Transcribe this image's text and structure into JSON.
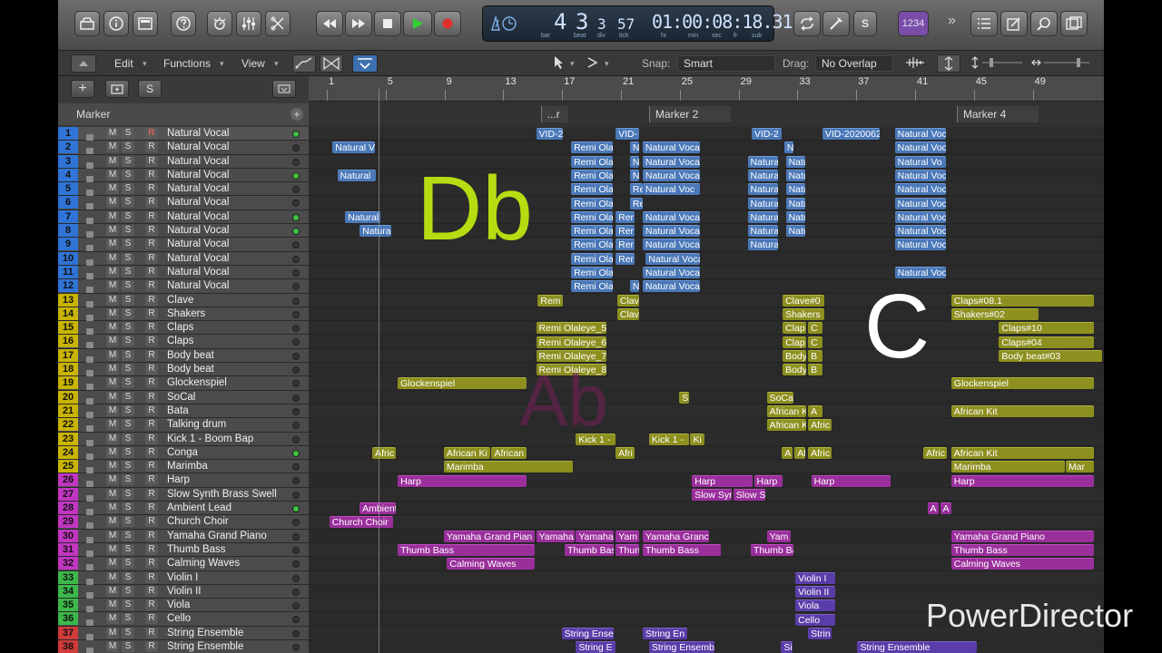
{
  "colors": {
    "blue": "#4a78b8",
    "yellow": "#8d8f1f",
    "magenta": "#9a2f9c",
    "purple": "#5a3da8",
    "accent_green": "#3ec43e",
    "count_in": "#7a4ea8"
  },
  "control_bar": {
    "lcd": {
      "bar": "4",
      "beat": "3",
      "div": "3",
      "tick": "57",
      "time": "01:00:08:18.31",
      "labels": {
        "bar": "bar",
        "beat": "beat",
        "div": "div",
        "tick": "tick",
        "hr": "hr",
        "min": "min",
        "sec": "sec",
        "fr": "fr",
        "sub": "sub"
      }
    },
    "count_in": "1234",
    "solo_label": "S"
  },
  "toolbar": {
    "edit": "Edit",
    "functions": "Functions",
    "view": "View",
    "snap_label": "Snap:",
    "snap_value": "Smart",
    "drag_label": "Drag:",
    "drag_value": "No Overlap"
  },
  "header": {
    "marker_label": "Marker",
    "add": "+",
    "solo": "S"
  },
  "ruler": {
    "ticks": [
      "1",
      "5",
      "9",
      "13",
      "17",
      "21",
      "25",
      "29",
      "33",
      "37",
      "41",
      "45",
      "49"
    ]
  },
  "markers": [
    {
      "label": "...r",
      "pos": 0.292
    },
    {
      "label": "Marker 2",
      "pos": 0.428
    },
    {
      "label": "Marker 4",
      "pos": 0.815
    }
  ],
  "tracks": [
    {
      "n": "1",
      "name": "Natural Vocal",
      "led": true
    },
    {
      "n": "2",
      "name": "Natural Vocal",
      "led": false
    },
    {
      "n": "3",
      "name": "Natural Vocal",
      "led": false
    },
    {
      "n": "4",
      "name": "Natural Vocal",
      "led": true
    },
    {
      "n": "5",
      "name": "Natural Vocal",
      "led": false
    },
    {
      "n": "6",
      "name": "Natural Vocal",
      "led": false
    },
    {
      "n": "7",
      "name": "Natural Vocal",
      "led": true
    },
    {
      "n": "8",
      "name": "Natural Vocal",
      "led": true
    },
    {
      "n": "9",
      "name": "Natural Vocal",
      "led": false
    },
    {
      "n": "10",
      "name": "Natural Vocal",
      "led": false
    },
    {
      "n": "11",
      "name": "Natural Vocal",
      "led": false
    },
    {
      "n": "12",
      "name": "Natural Vocal",
      "led": false
    },
    {
      "n": "13",
      "name": "Clave",
      "led": false
    },
    {
      "n": "14",
      "name": "Shakers",
      "led": false
    },
    {
      "n": "15",
      "name": "Claps",
      "led": false
    },
    {
      "n": "16",
      "name": "Claps",
      "led": false
    },
    {
      "n": "17",
      "name": "Body beat",
      "led": false
    },
    {
      "n": "18",
      "name": "Body beat",
      "led": false
    },
    {
      "n": "19",
      "name": "Glockenspiel",
      "led": false
    },
    {
      "n": "20",
      "name": "SoCal",
      "led": false
    },
    {
      "n": "21",
      "name": "Bata",
      "led": false
    },
    {
      "n": "22",
      "name": "Talking drum",
      "led": false
    },
    {
      "n": "23",
      "name": "Kick 1 - Boom Bap",
      "led": false
    },
    {
      "n": "24",
      "name": "Conga",
      "led": true
    },
    {
      "n": "25",
      "name": "Marimba",
      "led": false
    },
    {
      "n": "26",
      "name": "Harp",
      "led": false
    },
    {
      "n": "27",
      "name": "Slow Synth Brass Swell",
      "led": false
    },
    {
      "n": "28",
      "name": "Ambient Lead",
      "led": true
    },
    {
      "n": "29",
      "name": "Church Choir",
      "led": false
    },
    {
      "n": "30",
      "name": "Yamaha Grand Piano",
      "led": false
    },
    {
      "n": "31",
      "name": "Thumb Bass",
      "led": false
    },
    {
      "n": "32",
      "name": "Calming Waves",
      "led": false
    },
    {
      "n": "33",
      "name": "Violin I",
      "led": false
    },
    {
      "n": "34",
      "name": "Violin II",
      "led": false
    },
    {
      "n": "35",
      "name": "Viola",
      "led": false
    },
    {
      "n": "36",
      "name": "Cello",
      "led": false
    },
    {
      "n": "37",
      "name": "String Ensemble",
      "led": false
    },
    {
      "n": "38",
      "name": "String Ensemble",
      "led": false
    }
  ],
  "regions": [
    {
      "t": 0,
      "s": 0.286,
      "w": 0.034,
      "l": "VID-2",
      "c": "blue"
    },
    {
      "t": 0,
      "s": 0.386,
      "w": 0.03,
      "l": "VID-",
      "c": "blue"
    },
    {
      "t": 0,
      "s": 0.557,
      "w": 0.038,
      "l": "VID-2",
      "c": "blue"
    },
    {
      "t": 0,
      "s": 0.646,
      "w": 0.072,
      "l": "VID-2020062",
      "c": "blue"
    },
    {
      "t": 0,
      "s": 0.737,
      "w": 0.064,
      "l": "Natural Voc",
      "c": "blue"
    },
    {
      "t": 1,
      "s": 0.03,
      "w": 0.053,
      "l": "Natural V",
      "c": "blue"
    },
    {
      "t": 1,
      "s": 0.33,
      "w": 0.052,
      "l": "Remi Ola",
      "c": "blue"
    },
    {
      "t": 1,
      "s": 0.404,
      "w": 0.012,
      "l": "N",
      "c": "blue"
    },
    {
      "t": 1,
      "s": 0.42,
      "w": 0.072,
      "l": "Natural Voca",
      "c": "blue"
    },
    {
      "t": 1,
      "s": 0.598,
      "w": 0.012,
      "l": "N",
      "c": "blue"
    },
    {
      "t": 1,
      "s": 0.737,
      "w": 0.064,
      "l": "Natural Voc",
      "c": "blue"
    },
    {
      "t": 2,
      "s": 0.33,
      "w": 0.052,
      "l": "Remi Ola",
      "c": "blue"
    },
    {
      "t": 2,
      "s": 0.404,
      "w": 0.012,
      "l": "N",
      "c": "blue"
    },
    {
      "t": 2,
      "s": 0.42,
      "w": 0.072,
      "l": "Natural Voca",
      "c": "blue"
    },
    {
      "t": 2,
      "s": 0.552,
      "w": 0.038,
      "l": "Natura",
      "c": "blue"
    },
    {
      "t": 2,
      "s": 0.6,
      "w": 0.024,
      "l": "Natu",
      "c": "blue"
    },
    {
      "t": 2,
      "s": 0.737,
      "w": 0.064,
      "l": "Natural Vo",
      "c": "blue"
    },
    {
      "t": 3,
      "s": 0.036,
      "w": 0.048,
      "l": "Natural",
      "c": "blue"
    },
    {
      "t": 3,
      "s": 0.33,
      "w": 0.052,
      "l": "Remi Ola",
      "c": "blue"
    },
    {
      "t": 3,
      "s": 0.404,
      "w": 0.012,
      "l": "N",
      "c": "blue"
    },
    {
      "t": 3,
      "s": 0.42,
      "w": 0.072,
      "l": "Natural Voca",
      "c": "blue"
    },
    {
      "t": 3,
      "s": 0.552,
      "w": 0.038,
      "l": "Natura",
      "c": "blue"
    },
    {
      "t": 3,
      "s": 0.6,
      "w": 0.024,
      "l": "Natu",
      "c": "blue"
    },
    {
      "t": 3,
      "s": 0.737,
      "w": 0.064,
      "l": "Natural Voc",
      "c": "blue"
    },
    {
      "t": 4,
      "s": 0.33,
      "w": 0.052,
      "l": "Remi Ola",
      "c": "blue"
    },
    {
      "t": 4,
      "s": 0.404,
      "w": 0.016,
      "l": "Re",
      "c": "blue"
    },
    {
      "t": 4,
      "s": 0.42,
      "w": 0.072,
      "l": "Natural Voc",
      "c": "blue"
    },
    {
      "t": 4,
      "s": 0.552,
      "w": 0.038,
      "l": "Natura",
      "c": "blue"
    },
    {
      "t": 4,
      "s": 0.6,
      "w": 0.024,
      "l": "Natu",
      "c": "blue"
    },
    {
      "t": 4,
      "s": 0.737,
      "w": 0.064,
      "l": "Natural Voc",
      "c": "blue"
    },
    {
      "t": 5,
      "s": 0.33,
      "w": 0.052,
      "l": "Remi Ola",
      "c": "blue"
    },
    {
      "t": 5,
      "s": 0.404,
      "w": 0.016,
      "l": "Re",
      "c": "blue"
    },
    {
      "t": 5,
      "s": 0.552,
      "w": 0.038,
      "l": "Natura",
      "c": "blue"
    },
    {
      "t": 5,
      "s": 0.6,
      "w": 0.024,
      "l": "Natu",
      "c": "blue"
    },
    {
      "t": 5,
      "s": 0.737,
      "w": 0.064,
      "l": "Natural Voc",
      "c": "blue"
    },
    {
      "t": 6,
      "s": 0.046,
      "w": 0.044,
      "l": "Natural",
      "c": "blue"
    },
    {
      "t": 6,
      "s": 0.33,
      "w": 0.052,
      "l": "Remi Ola",
      "c": "blue"
    },
    {
      "t": 6,
      "s": 0.386,
      "w": 0.024,
      "l": "Rer",
      "c": "blue"
    },
    {
      "t": 6,
      "s": 0.42,
      "w": 0.072,
      "l": "Natural Voca",
      "c": "blue"
    },
    {
      "t": 6,
      "s": 0.552,
      "w": 0.038,
      "l": "Natura",
      "c": "blue"
    },
    {
      "t": 6,
      "s": 0.6,
      "w": 0.024,
      "l": "Natu",
      "c": "blue"
    },
    {
      "t": 6,
      "s": 0.737,
      "w": 0.064,
      "l": "Natural Voc",
      "c": "blue"
    },
    {
      "t": 7,
      "s": 0.064,
      "w": 0.04,
      "l": "Natura",
      "c": "blue"
    },
    {
      "t": 7,
      "s": 0.33,
      "w": 0.052,
      "l": "Remi Ola",
      "c": "blue"
    },
    {
      "t": 7,
      "s": 0.386,
      "w": 0.024,
      "l": "Rer",
      "c": "blue"
    },
    {
      "t": 7,
      "s": 0.42,
      "w": 0.072,
      "l": "Natural Voca",
      "c": "blue"
    },
    {
      "t": 7,
      "s": 0.552,
      "w": 0.038,
      "l": "Natura",
      "c": "blue"
    },
    {
      "t": 7,
      "s": 0.6,
      "w": 0.024,
      "l": "Natu",
      "c": "blue"
    },
    {
      "t": 7,
      "s": 0.737,
      "w": 0.064,
      "l": "Natural Voc",
      "c": "blue"
    },
    {
      "t": 8,
      "s": 0.33,
      "w": 0.052,
      "l": "Remi Ola",
      "c": "blue"
    },
    {
      "t": 8,
      "s": 0.386,
      "w": 0.024,
      "l": "Rer",
      "c": "blue"
    },
    {
      "t": 8,
      "s": 0.42,
      "w": 0.072,
      "l": "Natural Voca",
      "c": "blue"
    },
    {
      "t": 8,
      "s": 0.552,
      "w": 0.038,
      "l": "Natura",
      "c": "blue"
    },
    {
      "t": 8,
      "s": 0.737,
      "w": 0.064,
      "l": "Natural Voc",
      "c": "blue"
    },
    {
      "t": 9,
      "s": 0.33,
      "w": 0.052,
      "l": "Remi Ola",
      "c": "blue"
    },
    {
      "t": 9,
      "s": 0.386,
      "w": 0.024,
      "l": "Rer",
      "c": "blue"
    },
    {
      "t": 9,
      "s": 0.424,
      "w": 0.068,
      "l": "Natural Voca",
      "c": "blue"
    },
    {
      "t": 10,
      "s": 0.33,
      "w": 0.052,
      "l": "Remi Ola",
      "c": "blue"
    },
    {
      "t": 10,
      "s": 0.42,
      "w": 0.072,
      "l": "Natural Voca",
      "c": "blue"
    },
    {
      "t": 10,
      "s": 0.737,
      "w": 0.064,
      "l": "Natural Voc",
      "c": "blue"
    },
    {
      "t": 11,
      "s": 0.33,
      "w": 0.052,
      "l": "Remi Ola",
      "c": "blue"
    },
    {
      "t": 11,
      "s": 0.404,
      "w": 0.012,
      "l": "N",
      "c": "blue"
    },
    {
      "t": 11,
      "s": 0.42,
      "w": 0.072,
      "l": "Natural Voca",
      "c": "blue"
    },
    {
      "t": 12,
      "s": 0.288,
      "w": 0.032,
      "l": "Rem",
      "c": "yel"
    },
    {
      "t": 12,
      "s": 0.388,
      "w": 0.028,
      "l": "Clav",
      "c": "yel"
    },
    {
      "t": 12,
      "s": 0.596,
      "w": 0.052,
      "l": "Clave#0",
      "c": "yel"
    },
    {
      "t": 12,
      "s": 0.808,
      "w": 0.18,
      "l": "Claps#08.1",
      "c": "yel"
    },
    {
      "t": 13,
      "s": 0.388,
      "w": 0.028,
      "l": "Clav",
      "c": "yel"
    },
    {
      "t": 13,
      "s": 0.596,
      "w": 0.052,
      "l": "Shakers",
      "c": "yel"
    },
    {
      "t": 13,
      "s": 0.808,
      "w": 0.11,
      "l": "Shakers#02",
      "c": "yel"
    },
    {
      "t": 14,
      "s": 0.286,
      "w": 0.088,
      "l": "Remi Olaleye_5",
      "c": "yel"
    },
    {
      "t": 14,
      "s": 0.596,
      "w": 0.03,
      "l": "Clap",
      "c": "yel"
    },
    {
      "t": 14,
      "s": 0.628,
      "w": 0.018,
      "l": "C",
      "c": "yel"
    },
    {
      "t": 14,
      "s": 0.868,
      "w": 0.12,
      "l": "Claps#10",
      "c": "yel"
    },
    {
      "t": 15,
      "s": 0.286,
      "w": 0.088,
      "l": "Remi Olaleye_6",
      "c": "yel"
    },
    {
      "t": 15,
      "s": 0.596,
      "w": 0.03,
      "l": "Clap",
      "c": "yel"
    },
    {
      "t": 15,
      "s": 0.628,
      "w": 0.018,
      "l": "C",
      "c": "yel"
    },
    {
      "t": 15,
      "s": 0.868,
      "w": 0.12,
      "l": "Claps#04",
      "c": "yel"
    },
    {
      "t": 16,
      "s": 0.286,
      "w": 0.088,
      "l": "Remi Olaleye_7",
      "c": "yel"
    },
    {
      "t": 16,
      "s": 0.596,
      "w": 0.03,
      "l": "Body",
      "c": "yel"
    },
    {
      "t": 16,
      "s": 0.628,
      "w": 0.018,
      "l": "B",
      "c": "yel"
    },
    {
      "t": 16,
      "s": 0.868,
      "w": 0.13,
      "l": "Body beat#03",
      "c": "yel"
    },
    {
      "t": 17,
      "s": 0.286,
      "w": 0.088,
      "l": "Remi Olaleye_8",
      "c": "yel"
    },
    {
      "t": 17,
      "s": 0.596,
      "w": 0.03,
      "l": "Body",
      "c": "yel"
    },
    {
      "t": 17,
      "s": 0.628,
      "w": 0.018,
      "l": "B",
      "c": "yel"
    },
    {
      "t": 18,
      "s": 0.112,
      "w": 0.162,
      "l": "Glockenspiel",
      "c": "yel"
    },
    {
      "t": 18,
      "s": 0.808,
      "w": 0.18,
      "l": "Glockenspiel",
      "c": "yel"
    },
    {
      "t": 19,
      "s": 0.466,
      "w": 0.012,
      "l": "S",
      "c": "yel"
    },
    {
      "t": 19,
      "s": 0.576,
      "w": 0.034,
      "l": "SoCa",
      "c": "yel"
    },
    {
      "t": 20,
      "s": 0.576,
      "w": 0.05,
      "l": "African K",
      "c": "yel"
    },
    {
      "t": 20,
      "s": 0.628,
      "w": 0.018,
      "l": "A",
      "c": "yel"
    },
    {
      "t": 20,
      "s": 0.808,
      "w": 0.18,
      "l": "African Kit",
      "c": "yel"
    },
    {
      "t": 21,
      "s": 0.576,
      "w": 0.05,
      "l": "African K",
      "c": "yel"
    },
    {
      "t": 21,
      "s": 0.628,
      "w": 0.03,
      "l": "Afric",
      "c": "yel"
    },
    {
      "t": 22,
      "s": 0.336,
      "w": 0.05,
      "l": "Kick 1 -",
      "c": "yel"
    },
    {
      "t": 22,
      "s": 0.428,
      "w": 0.05,
      "l": "Kick 1 -",
      "c": "yel"
    },
    {
      "t": 22,
      "s": 0.48,
      "w": 0.018,
      "l": "Ki",
      "c": "yel"
    },
    {
      "t": 23,
      "s": 0.08,
      "w": 0.03,
      "l": "Afric",
      "c": "yel"
    },
    {
      "t": 23,
      "s": 0.17,
      "w": 0.058,
      "l": "African Ki",
      "c": "yel"
    },
    {
      "t": 23,
      "s": 0.23,
      "w": 0.044,
      "l": "African",
      "c": "yel"
    },
    {
      "t": 23,
      "s": 0.386,
      "w": 0.024,
      "l": "Afri",
      "c": "yel"
    },
    {
      "t": 23,
      "s": 0.595,
      "w": 0.014,
      "l": "A",
      "c": "yel"
    },
    {
      "t": 23,
      "s": 0.611,
      "w": 0.014,
      "l": "Af",
      "c": "yel"
    },
    {
      "t": 23,
      "s": 0.628,
      "w": 0.03,
      "l": "Afric",
      "c": "yel"
    },
    {
      "t": 23,
      "s": 0.773,
      "w": 0.03,
      "l": "Afric",
      "c": "yel"
    },
    {
      "t": 23,
      "s": 0.808,
      "w": 0.18,
      "l": "African Kit",
      "c": "yel"
    },
    {
      "t": 24,
      "s": 0.17,
      "w": 0.162,
      "l": "Marimba",
      "c": "yel"
    },
    {
      "t": 24,
      "s": 0.808,
      "w": 0.143,
      "l": "Marimba",
      "c": "yel"
    },
    {
      "t": 24,
      "s": 0.952,
      "w": 0.036,
      "l": "Mar",
      "c": "yel"
    },
    {
      "t": 25,
      "s": 0.112,
      "w": 0.162,
      "l": "Harp",
      "c": "mag"
    },
    {
      "t": 25,
      "s": 0.482,
      "w": 0.076,
      "l": "Harp",
      "c": "mag"
    },
    {
      "t": 25,
      "s": 0.56,
      "w": 0.036,
      "l": "Harp",
      "c": "mag"
    },
    {
      "t": 25,
      "s": 0.632,
      "w": 0.1,
      "l": "Harp",
      "c": "mag"
    },
    {
      "t": 25,
      "s": 0.808,
      "w": 0.18,
      "l": "Harp",
      "c": "mag"
    },
    {
      "t": 26,
      "s": 0.482,
      "w": 0.05,
      "l": "Slow Syr",
      "c": "mag"
    },
    {
      "t": 26,
      "s": 0.534,
      "w": 0.04,
      "l": "Slow S",
      "c": "mag"
    },
    {
      "t": 27,
      "s": 0.064,
      "w": 0.046,
      "l": "Ambient",
      "c": "mag"
    },
    {
      "t": 27,
      "s": 0.778,
      "w": 0.014,
      "l": "A",
      "c": "mag"
    },
    {
      "t": 27,
      "s": 0.794,
      "w": 0.014,
      "l": "A",
      "c": "mag"
    },
    {
      "t": 28,
      "s": 0.026,
      "w": 0.08,
      "l": "Church Choir",
      "c": "mag"
    },
    {
      "t": 29,
      "s": 0.17,
      "w": 0.114,
      "l": "Yamaha Grand Pian",
      "c": "mag"
    },
    {
      "t": 29,
      "s": 0.286,
      "w": 0.048,
      "l": "Yamaha",
      "c": "mag"
    },
    {
      "t": 29,
      "s": 0.336,
      "w": 0.048,
      "l": "Yamaha",
      "c": "mag"
    },
    {
      "t": 29,
      "s": 0.386,
      "w": 0.03,
      "l": "Yam",
      "c": "mag"
    },
    {
      "t": 29,
      "s": 0.42,
      "w": 0.084,
      "l": "Yamaha Granc",
      "c": "mag"
    },
    {
      "t": 29,
      "s": 0.576,
      "w": 0.03,
      "l": "Yam",
      "c": "mag"
    },
    {
      "t": 29,
      "s": 0.808,
      "w": 0.18,
      "l": "Yamaha Grand Piano",
      "c": "mag"
    },
    {
      "t": 30,
      "s": 0.112,
      "w": 0.172,
      "l": "Thumb Bass",
      "c": "mag"
    },
    {
      "t": 30,
      "s": 0.322,
      "w": 0.062,
      "l": "Thumb Bas",
      "c": "mag"
    },
    {
      "t": 30,
      "s": 0.386,
      "w": 0.03,
      "l": "Thun",
      "c": "mag"
    },
    {
      "t": 30,
      "s": 0.42,
      "w": 0.098,
      "l": "Thumb Bass",
      "c": "mag"
    },
    {
      "t": 30,
      "s": 0.556,
      "w": 0.054,
      "l": "Thumb Ba",
      "c": "mag"
    },
    {
      "t": 30,
      "s": 0.808,
      "w": 0.18,
      "l": "Thumb Bass",
      "c": "mag"
    },
    {
      "t": 31,
      "s": 0.174,
      "w": 0.11,
      "l": "Calming Waves",
      "c": "mag"
    },
    {
      "t": 31,
      "s": 0.808,
      "w": 0.18,
      "l": "Calming Waves",
      "c": "mag"
    },
    {
      "t": 32,
      "s": 0.612,
      "w": 0.05,
      "l": "Violin I",
      "c": "pur"
    },
    {
      "t": 33,
      "s": 0.612,
      "w": 0.05,
      "l": "Violin II",
      "c": "pur"
    },
    {
      "t": 34,
      "s": 0.612,
      "w": 0.05,
      "l": "Viola",
      "c": "pur"
    },
    {
      "t": 35,
      "s": 0.612,
      "w": 0.05,
      "l": "Cello",
      "c": "pur"
    },
    {
      "t": 36,
      "s": 0.318,
      "w": 0.066,
      "l": "String Ense",
      "c": "pur"
    },
    {
      "t": 36,
      "s": 0.42,
      "w": 0.056,
      "l": "String En",
      "c": "pur"
    },
    {
      "t": 36,
      "s": 0.628,
      "w": 0.03,
      "l": "Strin",
      "c": "pur"
    },
    {
      "t": 37,
      "s": 0.336,
      "w": 0.05,
      "l": "String E",
      "c": "pur"
    },
    {
      "t": 37,
      "s": 0.428,
      "w": 0.082,
      "l": "String Ensemb",
      "c": "pur"
    },
    {
      "t": 37,
      "s": 0.594,
      "w": 0.014,
      "l": "Si",
      "c": "pur"
    },
    {
      "t": 37,
      "s": 0.69,
      "w": 0.15,
      "l": "String Ensemble",
      "c": "pur"
    }
  ],
  "overlays": {
    "db": "Db",
    "c": "C",
    "ab": "Ab"
  },
  "watermark": "PowerDirector"
}
